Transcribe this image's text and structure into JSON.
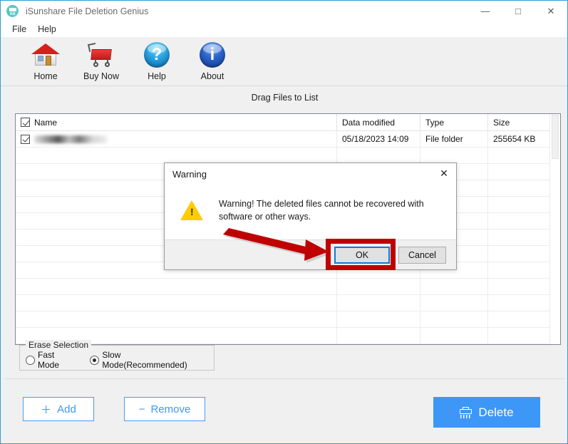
{
  "window": {
    "title": "iSunshare File Deletion Genius",
    "app_icon": "shredder-icon",
    "minimize": "—",
    "maximize": "□",
    "close": "✕"
  },
  "menubar": {
    "items": [
      {
        "label": "File"
      },
      {
        "label": "Help"
      }
    ]
  },
  "toolbar": {
    "items": [
      {
        "label": "Home",
        "icon": "home-icon"
      },
      {
        "label": "Buy Now",
        "icon": "shopping-cart-icon"
      },
      {
        "label": "Help",
        "icon": "question-mark-icon",
        "glyph": "?"
      },
      {
        "label": "About",
        "icon": "info-icon",
        "glyph": "i"
      }
    ]
  },
  "main": {
    "drag_hint": "Drag Files to List",
    "filelist": {
      "columns": [
        "Name",
        "Data modified",
        "Type",
        "Size"
      ],
      "header_checkbox_checked": true,
      "rows": [
        {
          "checked": true,
          "name": "",
          "date_modified": "05/18/2023 14:09",
          "type": "File folder",
          "size": "255654 KB",
          "redacted": true
        }
      ],
      "empty_row_count": 12
    }
  },
  "erase_selection": {
    "legend": "Erase Selection",
    "options": [
      {
        "label": "Fast Mode",
        "selected": false
      },
      {
        "label": "Slow Mode(Recommended)",
        "selected": true
      }
    ]
  },
  "footer": {
    "add_label": "Add",
    "add_glyph": "＋",
    "remove_label": "Remove",
    "remove_glyph": "−",
    "delete_label": "Delete",
    "delete_icon": "shredder-icon"
  },
  "dialog": {
    "title": "Warning",
    "close": "✕",
    "icon": "warning-triangle-icon",
    "icon_glyph": "!",
    "message": "Warning! The deleted files cannot be recovered with software or other ways.",
    "ok_label": "OK",
    "cancel_label": "Cancel"
  },
  "annotations": {
    "highlight_target": "OK",
    "arrow_color": "#c00000",
    "highlight_color": "#c00000"
  },
  "colors": {
    "accent_blue": "#3d97f7",
    "window_border": "#2b9fd4",
    "panel_bg": "#f0f0f0",
    "warning_yellow": "#ffcc00",
    "annotation_red": "#c00000",
    "focus_blue": "#0a7ddb"
  }
}
